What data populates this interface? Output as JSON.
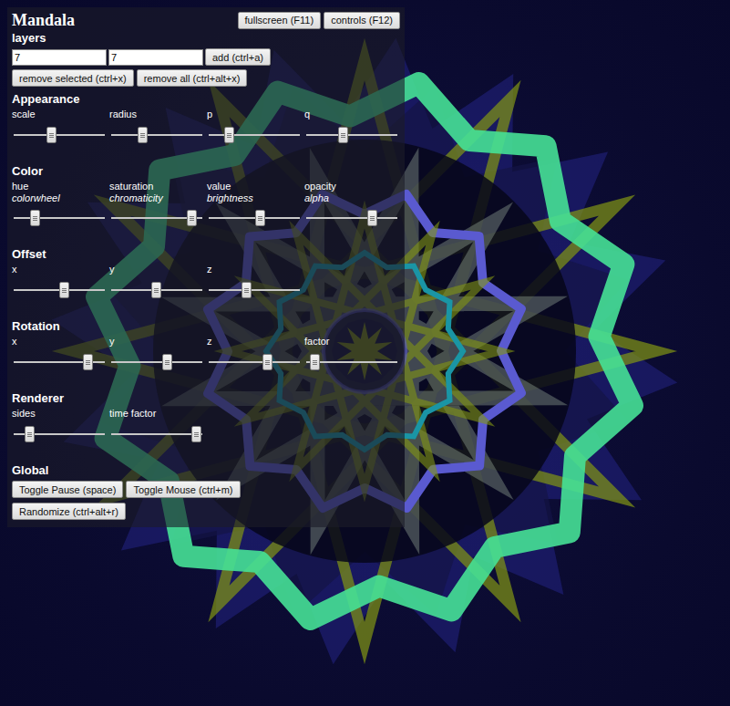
{
  "title": "Mandala",
  "header_buttons": [
    "fullscreen (F11)",
    "controls (F12)"
  ],
  "layers": {
    "heading": "layers",
    "inputs": [
      "7",
      "7"
    ],
    "add_button": "add (ctrl+a)",
    "buttons": [
      "remove selected (ctrl+x)",
      "remove all (ctrl+alt+x)"
    ]
  },
  "sections": [
    {
      "heading": "Appearance",
      "sliders": [
        {
          "label": "scale",
          "level": 0.42
        },
        {
          "label": "radius",
          "level": 0.35
        },
        {
          "label": "p",
          "level": 0.23
        },
        {
          "label": "q",
          "level": 0.41
        }
      ]
    },
    {
      "heading": "Color",
      "sliders": [
        {
          "label": "hue",
          "sublabel": "colorwheel",
          "level": 0.24
        },
        {
          "label": "saturation",
          "sublabel": "chromaticity",
          "level": 0.89
        },
        {
          "label": "value",
          "sublabel": "brightness",
          "level": 0.57
        },
        {
          "label": "opacity",
          "sublabel": "alpha",
          "level": 0.73
        }
      ]
    },
    {
      "heading": "Offset",
      "sliders": [
        {
          "label": "x",
          "level": 0.56
        },
        {
          "label": "y",
          "level": 0.5
        },
        {
          "label": "z",
          "level": 0.42
        }
      ]
    },
    {
      "heading": "Rotation",
      "sliders": [
        {
          "label": "x",
          "level": 0.82
        },
        {
          "label": "y",
          "level": 0.62
        },
        {
          "label": "z",
          "level": 0.65
        },
        {
          "label": "factor",
          "level": 0.1
        }
      ]
    },
    {
      "heading": "Renderer",
      "sliders": [
        {
          "label": "sides",
          "level": 0.18
        },
        {
          "label": "time factor",
          "level": 0.94
        }
      ]
    }
  ],
  "global": {
    "heading": "Global",
    "buttons": [
      "Toggle Pause (space)",
      "Toggle Mouse (ctrl+m)",
      "Randomize (ctrl+alt+r)"
    ]
  }
}
